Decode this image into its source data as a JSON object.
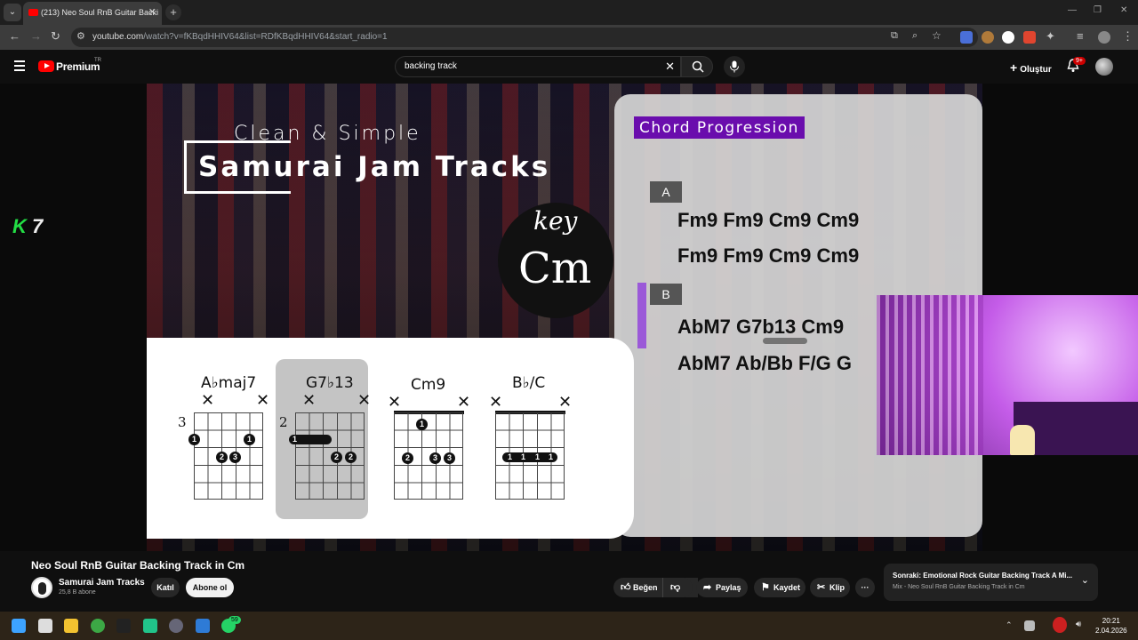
{
  "browser": {
    "tab_count_title": "(213) Neo Soul RnB Guitar Backi",
    "tab_close": "✕",
    "new_tab": "+",
    "url_host": "youtube.com",
    "url_path": "/watch?v=fKBqdHHIV64&list=RDfKBqdHHIV64&start_radio=1"
  },
  "masthead": {
    "brand": "Premium",
    "region": "TR",
    "search_value": "backing track",
    "create_label": "Oluştur",
    "notif_badge": "9+"
  },
  "video": {
    "overlay_logo_k": "K",
    "overlay_logo_num": "7",
    "title_small": "Clean & Simple",
    "title_big": "Samurai Jam Tracks",
    "key_label": "key",
    "key_value": "Cm",
    "progression_title": "Chord Progression",
    "sections": [
      {
        "label": "A",
        "lines": [
          "Fm9 Fm9 Cm9 Cm9",
          "Fm9 Fm9 Cm9 Cm9"
        ]
      },
      {
        "label": "B",
        "lines": [
          "AbM7 G7b13 Cm9",
          "AbM7 Ab/Bb F/G G"
        ]
      }
    ],
    "chords": [
      {
        "name": "A♭maj7",
        "fret": "3",
        "dots": [
          "1",
          "1",
          "2",
          "3"
        ]
      },
      {
        "name": "G7♭13",
        "fret": "2",
        "dots": [
          "1",
          "2",
          "2"
        ]
      },
      {
        "name": "Cm9",
        "fret": "",
        "dots": [
          "1",
          "2",
          "3",
          "3"
        ]
      },
      {
        "name": "B♭/C",
        "fret": "",
        "dots": [
          "1",
          "1",
          "1",
          "1"
        ]
      }
    ],
    "mute_mark": "✕"
  },
  "watch": {
    "title": "Neo Soul RnB Guitar Backing Track in Cm",
    "channel": "Samurai Jam Tracks",
    "subscribers": "25,8 B abone",
    "join_label": "Katıl",
    "subscribe_label": "Abone ol",
    "like_label": "Beğen",
    "share_label": "Paylaş",
    "save_label": "Kaydet",
    "clip_label": "Klip",
    "more_label": "···",
    "next_title": "Sonraki: Emotional Rock Guitar Backing Track A Mi...",
    "next_sub": "Mix - Neo Soul RnB Guitar Backing Track in Cm"
  },
  "taskbar": {
    "time": "20:21",
    "date": "2.04.2026",
    "whatsapp_badge": "59"
  },
  "colors": {
    "progression_title_bg": "#6a0dad",
    "section_b_bar": "#9b59d8",
    "yt_red": "#ff0000",
    "k7_green": "#22dd44"
  }
}
